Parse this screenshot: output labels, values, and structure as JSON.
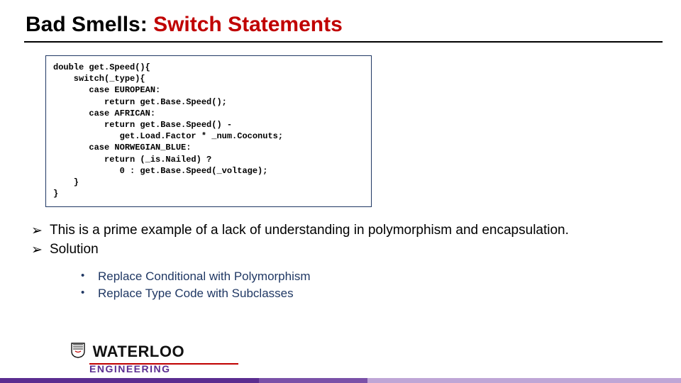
{
  "title": {
    "prefix": "Bad Smells: ",
    "highlight": "Switch Statements"
  },
  "code": {
    "l1_a": "double",
    "l1_b": " get.Speed(){",
    "l2_a": "    switch",
    "l2_b": "(_type){",
    "l3_a": "       case",
    "l3_b": " EUROPEAN:",
    "l4_a": "          return",
    "l4_b": " get.Base.Speed();",
    "l5_a": "       case",
    "l5_b": " AFRICAN:",
    "l6_a": "          return",
    "l6_b": " get.Base.Speed() -",
    "l7": "             get.Load.Factor * _num.Coconuts;",
    "l8_a": "       case",
    "l8_b": " NORWEGIAN_BLUE:",
    "l9_a": "          return",
    "l9_b": " (_is.Nailed) ?",
    "l10": "             0 : get.Base.Speed(_voltage);",
    "l11": "    }",
    "l12": "}"
  },
  "bullets": {
    "b1": "This is a prime example of a lack of understanding in polymorphism and encapsulation.",
    "b2": "Solution",
    "sub1": "Replace Conditional with Polymorphism",
    "sub2": "Replace Type Code with Subclasses",
    "arrow": "➢",
    "dot": "•"
  },
  "logo": {
    "main": "WATERLOO",
    "sub": "ENGINEERING"
  }
}
